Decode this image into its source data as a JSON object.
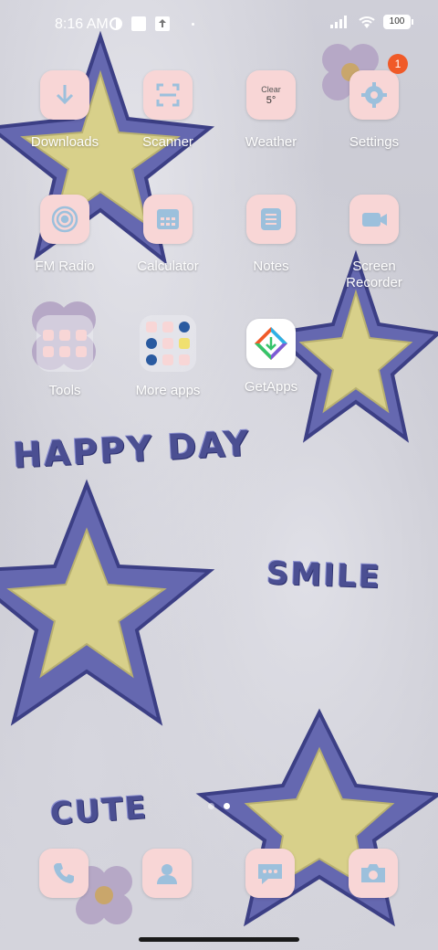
{
  "status_bar": {
    "time": "8:16 AM",
    "battery": "100"
  },
  "apps": [
    {
      "label": "Downloads",
      "icon": "download-icon"
    },
    {
      "label": "Scanner",
      "icon": "scan-icon"
    },
    {
      "label": "Weather",
      "icon": "weather-icon",
      "widget_line1": "Clear",
      "widget_line2": "5°"
    },
    {
      "label": "Settings",
      "icon": "gear-icon",
      "badge": "1"
    },
    {
      "label": "FM Radio",
      "icon": "radio-icon"
    },
    {
      "label": "Calculator",
      "icon": "calculator-icon"
    },
    {
      "label": "Notes",
      "icon": "notes-icon"
    },
    {
      "label": "Screen Recorder",
      "icon": "video-camera-icon"
    },
    {
      "label": "Tools",
      "icon": "folder-icon"
    },
    {
      "label": "More apps",
      "icon": "folder-icon"
    },
    {
      "label": "GetApps",
      "icon": "getapps-icon"
    }
  ],
  "dock": [
    {
      "icon": "phone-icon"
    },
    {
      "icon": "contacts-icon"
    },
    {
      "icon": "messages-icon"
    },
    {
      "icon": "camera-icon"
    }
  ],
  "wallpaper": {
    "text1": "HAPPY DAY",
    "text2": "SMILE",
    "text3": "CUTE"
  },
  "colors": {
    "icon_bg": "#f8d6d6",
    "icon_glyph": "#9cc0dc",
    "badge": "#f05a28",
    "star_outline": "#5c5fa8",
    "star_fill": "#d8d08a"
  }
}
